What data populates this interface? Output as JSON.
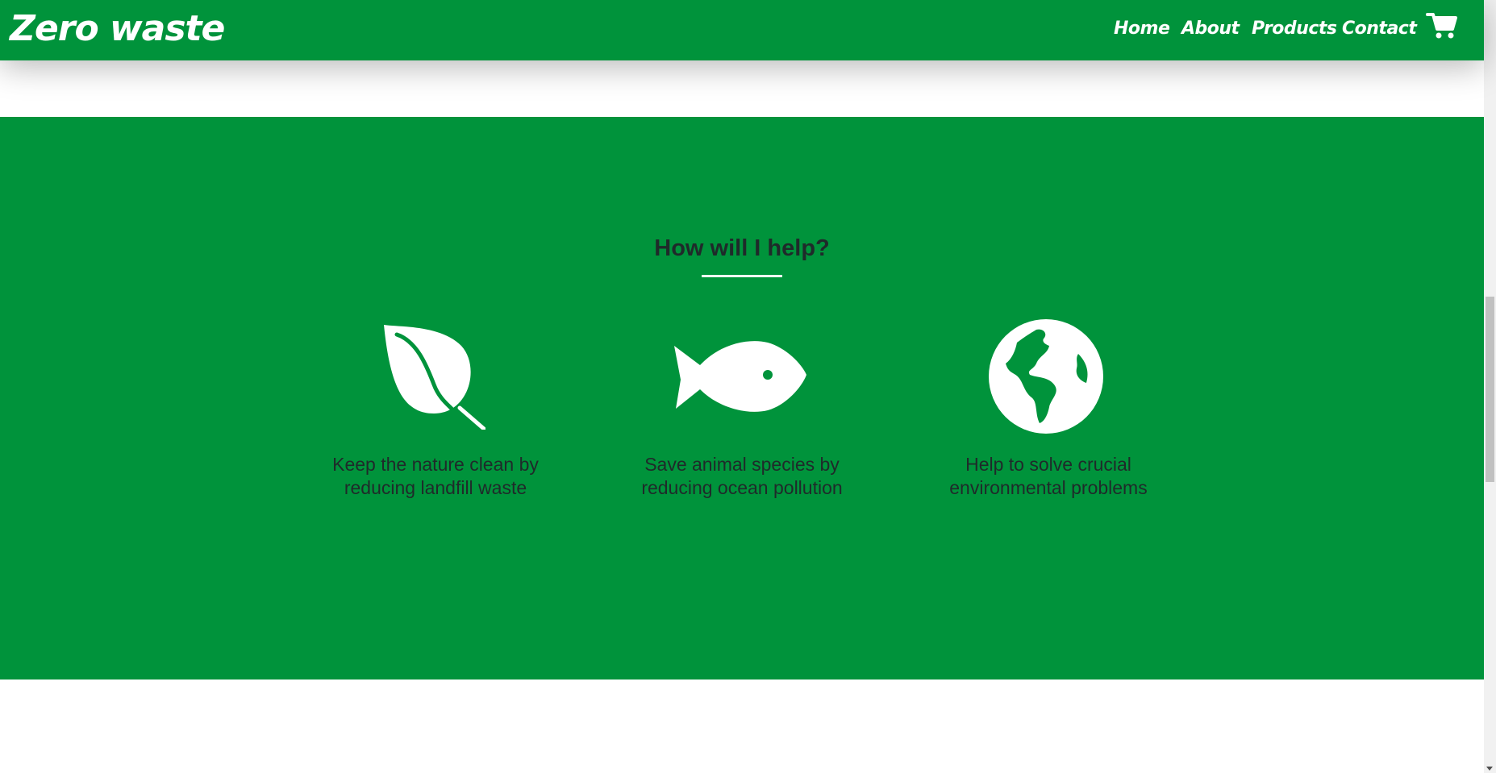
{
  "header": {
    "brand": "Zero waste",
    "nav": [
      {
        "label": "Home"
      },
      {
        "label": "About"
      },
      {
        "label": "Products"
      },
      {
        "label": "Contact"
      }
    ],
    "cart_icon": "shopping-cart-icon"
  },
  "section": {
    "title": "How will I help?",
    "features": [
      {
        "icon": "leaf-icon",
        "line1": "Keep the nature clean by",
        "line2": "reducing landfill waste"
      },
      {
        "icon": "fish-icon",
        "line1": "Save animal species by",
        "line2": "reducing ocean pollution"
      },
      {
        "icon": "globe-icon",
        "line1": "Help to solve crucial",
        "line2": "environmental problems"
      }
    ]
  },
  "colors": {
    "primary_green": "#00933b",
    "text_dark": "#1f2a2a",
    "white": "#ffffff"
  }
}
